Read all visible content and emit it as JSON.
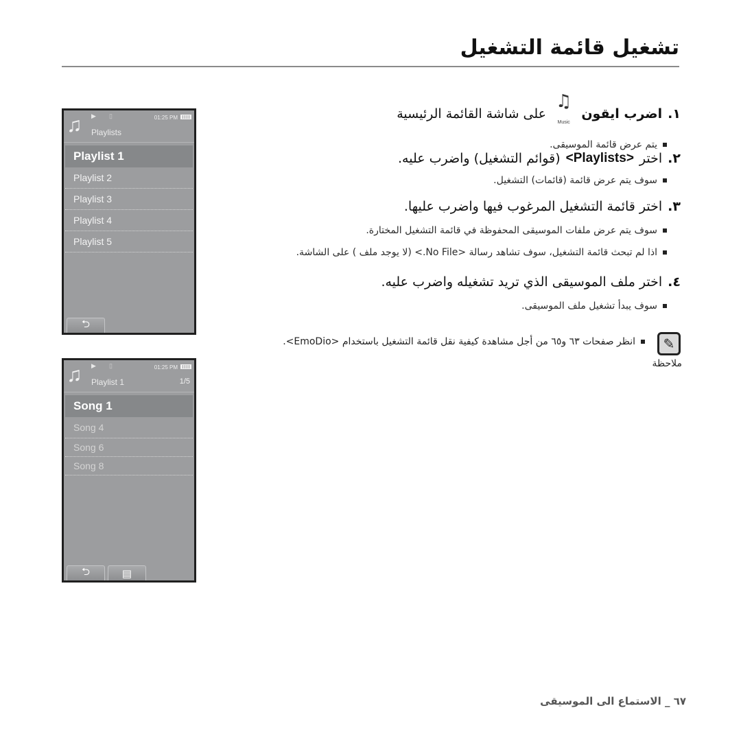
{
  "header": {
    "title": "تشغيل قائمة التشغيل"
  },
  "steps": [
    {
      "number": "١.",
      "text_before_icon": "اضرب ايقون",
      "icon": "music-note-icon",
      "icon_label": "Music",
      "text_after_icon": "على شاشة القائمة الرئيسية",
      "bullets": [
        "يتم عرض قائمة الموسيقى."
      ]
    },
    {
      "number": "٢.",
      "text_prefix": "اختر",
      "highlight": "<Playlists>",
      "text_suffix": "(قوائم التشغيل) واضرب عليه.",
      "bullets": [
        "سوف يتم عرض قائمة (قائمات) التشغيل."
      ]
    },
    {
      "number": "٣.",
      "text": "اختر قائمة التشغيل المرغوب فيها واضرب عليها.",
      "bullets": [
        "سوف يتم عرض ملفات الموسيقى المحفوظة في قائمة التشغيل المختارة.",
        "اذا لم تبحث قائمة التشغيل، سوف تشاهد رسالة <No File.> (لا يوجد ملف ) على الشاشة."
      ]
    },
    {
      "number": "٤.",
      "text": "اختر ملف الموسيقى الذي تريد تشغيله واضرب عليه.",
      "bullets": [
        "سوف يبدأ تشغيل ملف الموسيقى."
      ]
    }
  ],
  "note": {
    "icon": "note-pen-icon",
    "label": "ملاحظة",
    "text": "انظر صفحات ٦٣ و٦٥ من أجل مشاهدة كيفية نقل قائمة التشغيل باستخدام <EmoDio>."
  },
  "screen1": {
    "time": "01:25 PM",
    "title": "Playlists",
    "selected": "Playlist 1",
    "items": [
      "Playlist 2",
      "Playlist 3",
      "Playlist 4",
      "Playlist 5"
    ],
    "softkeys": [
      "back-icon"
    ]
  },
  "screen2": {
    "time": "01:25 PM",
    "title": "Playlist 1",
    "count": "1/5",
    "selected": "Song 1",
    "items": [
      "Song 4",
      "Song 6",
      "Song 8"
    ],
    "softkeys": [
      "back-icon",
      "list-menu-icon"
    ]
  },
  "footer": {
    "page_label": "٦٧ _ الاستماع الى الموسيقى"
  },
  "glyphs": {
    "music": "♫",
    "play": "▶",
    "bt": "▯",
    "back": "⮌",
    "menu": "▤",
    "pen": "✎"
  }
}
